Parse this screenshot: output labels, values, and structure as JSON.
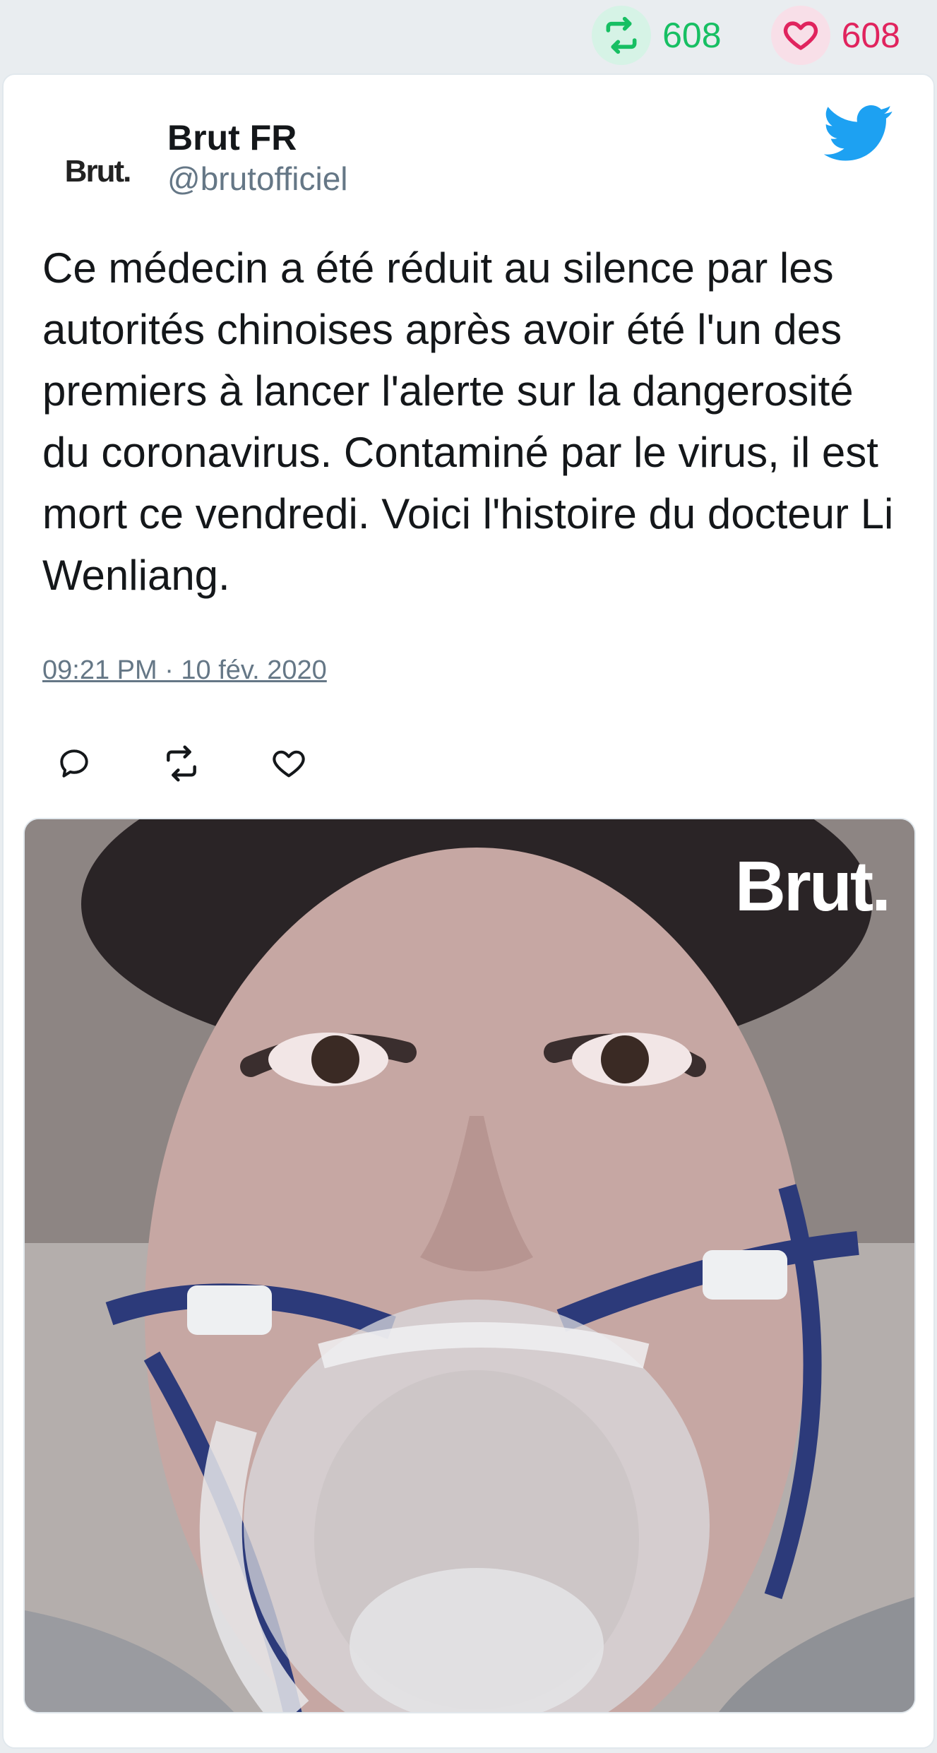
{
  "stats": {
    "retweet_count": "608",
    "like_count": "608",
    "retweet_color": "#17bf63",
    "like_color": "#e0245e"
  },
  "tweet": {
    "author_avatar_text": "Brut.",
    "author_name": "Brut FR",
    "author_handle": "@brutofficiel",
    "text": "Ce médecin a été réduit au silence par les autorités chinoises après avoir été l'un des premiers à lancer l'alerte sur la dangerosité du coronavirus. Contaminé par le virus, il est mort ce vendredi. Voici l'histoire du docteur Li Wenliang.",
    "timestamp": "09:21 PM · 10 fév. 2020",
    "media_watermark": "Brut.",
    "brand_color": "#1da1f2"
  },
  "icons": {
    "stats_retweet": "retweet-icon",
    "stats_like": "heart-icon",
    "brand": "twitter-bird-icon",
    "reply": "reply-icon",
    "retweet": "retweet-icon",
    "like": "heart-icon"
  }
}
